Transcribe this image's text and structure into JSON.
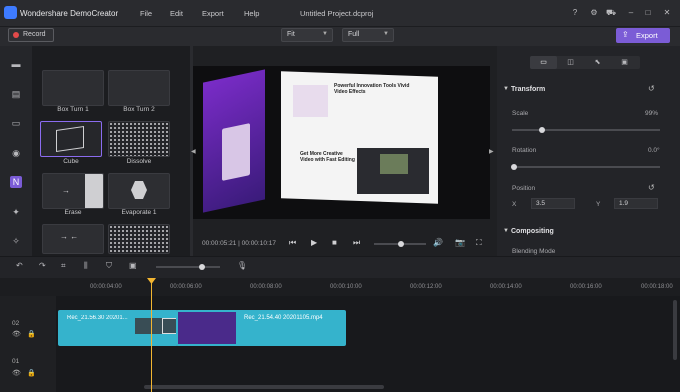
{
  "app": {
    "name": "Wondershare DemoCreator",
    "project": "Untitled Project.dcproj"
  },
  "menu": [
    "File",
    "Edit",
    "Export",
    "Help"
  ],
  "toolbar": {
    "record_label": "Record",
    "fit_value": "Fit",
    "full_value": "Full",
    "export_label": "Export"
  },
  "sidebar": {
    "icons": [
      "media-icon",
      "library-icon",
      "annotation-icon",
      "cursor-effects-icon",
      "transitions-icon",
      "effects-icon",
      "audio-icon"
    ],
    "active": "transitions-icon"
  },
  "transitions": [
    {
      "name": "Box Turn 1"
    },
    {
      "name": "Box Turn 2"
    },
    {
      "name": "Cube"
    },
    {
      "name": "Dissolve"
    },
    {
      "name": "Erase"
    },
    {
      "name": "Evaporate 1"
    },
    {
      "name": ""
    },
    {
      "name": ""
    }
  ],
  "preview": {
    "heading": "Powerful Innovation Tools Vivid Video Effects",
    "sub_heading": "Get More Creative Video with Fast Editing",
    "time_current": "00:00:05:21",
    "time_total": "00:00:10:17"
  },
  "properties": {
    "section_transform": "Transform",
    "scale_label": "Scale",
    "scale_value": "99%",
    "scale_fraction": 0.99,
    "rotation_label": "Rotation",
    "rotation_value": "0.0°",
    "position_label": "Position",
    "x_label": "X",
    "x_value": "3.5",
    "y_label": "Y",
    "y_value": "1.9",
    "section_compositing": "Compositing",
    "blending_label": "Blending Mode"
  },
  "timeline": {
    "ruler": [
      "00:00:04:00",
      "00:00:06:00",
      "00:00:08:00",
      "00:00:10:00",
      "00:00:12:00",
      "00:00:14:00",
      "00:00:16:00",
      "00:00:18:00"
    ],
    "track_labels": [
      "02",
      "01"
    ],
    "clips": [
      "Rec_21.56.30 20201...",
      "Rec_21.54.40 20201105.mp4"
    ]
  },
  "colors": {
    "accent": "#7b5cd6",
    "clip": "#35b3cc",
    "playhead": "#f2b531",
    "record": "#e24a4a"
  }
}
